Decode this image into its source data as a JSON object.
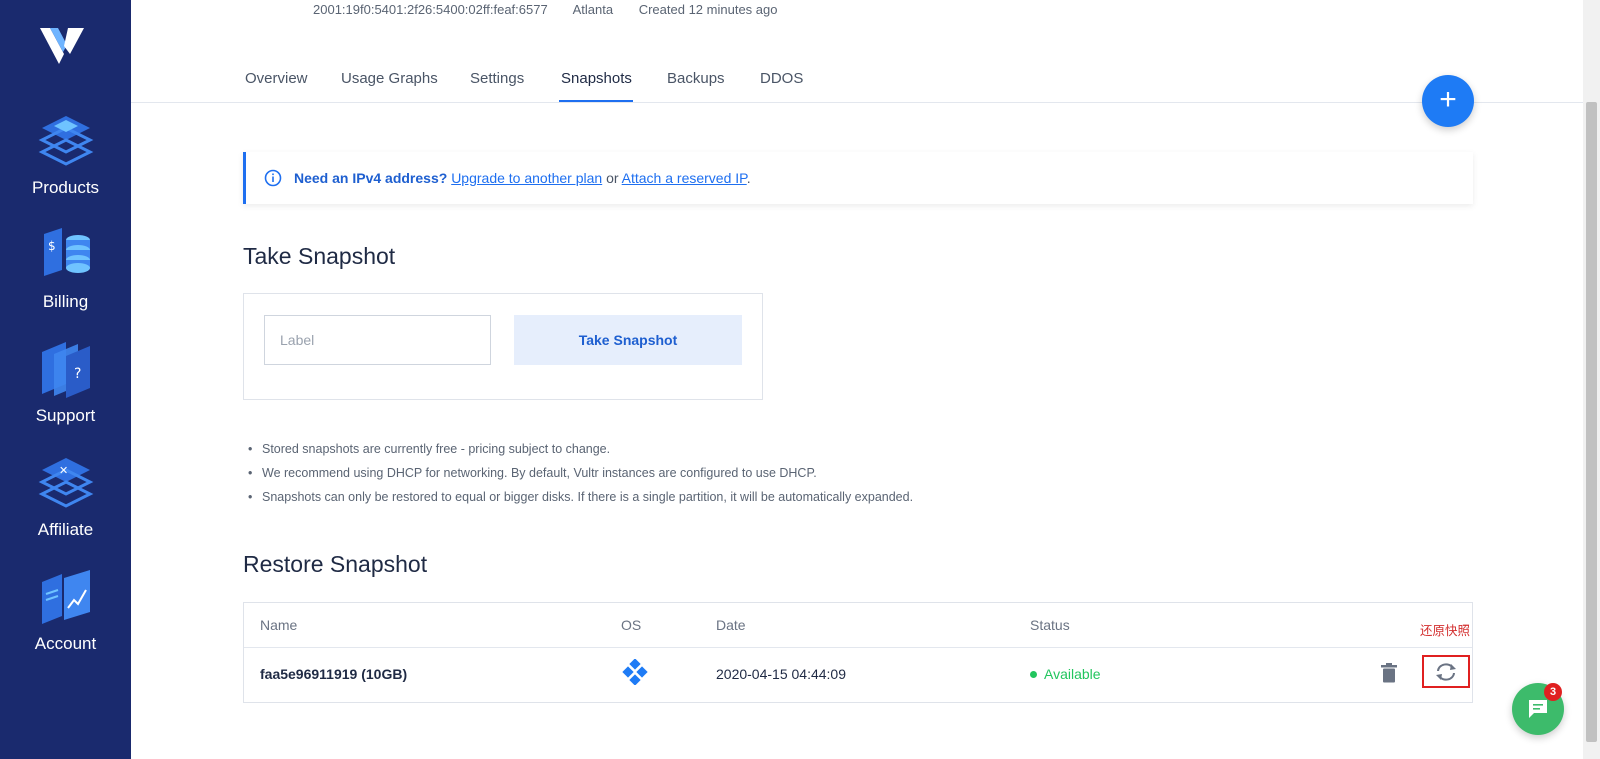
{
  "sidebar": {
    "items": [
      {
        "label": "Products",
        "icon": "products-icon"
      },
      {
        "label": "Billing",
        "icon": "billing-icon"
      },
      {
        "label": "Support",
        "icon": "support-icon"
      },
      {
        "label": "Affiliate",
        "icon": "affiliate-icon"
      },
      {
        "label": "Account",
        "icon": "account-icon"
      }
    ]
  },
  "server": {
    "ipv6": "2001:19f0:5401:2f26:5400:02ff:feaf:6577",
    "location": "Atlanta",
    "created": "Created 12 minutes ago"
  },
  "tabs": [
    "Overview",
    "Usage Graphs",
    "Settings",
    "Snapshots",
    "Backups",
    "DDOS"
  ],
  "active_tab": "Snapshots",
  "fab_label": "+",
  "alert": {
    "bold": "Need an IPv4 address?",
    "link1": "Upgrade to another plan",
    "or": "or",
    "link2": "Attach a reserved IP",
    "end": "."
  },
  "take_snapshot": {
    "heading": "Take Snapshot",
    "label_placeholder": "Label",
    "button": "Take Snapshot"
  },
  "notes": [
    "Stored snapshots are currently free - pricing subject to change.",
    "We recommend using DHCP for networking. By default, Vultr instances are configured to use DHCP.",
    "Snapshots can only be restored to equal or bigger disks. If there is a single partition, it will be automatically expanded."
  ],
  "restore_snapshot": {
    "heading": "Restore Snapshot",
    "columns": [
      "Name",
      "OS",
      "Date",
      "Status"
    ],
    "rows": [
      {
        "name": "faa5e96911919 (10GB)",
        "os_icon": "os-icon",
        "date": "2020-04-15 04:44:09",
        "status": "Available"
      }
    ],
    "annotation": "还原快照"
  },
  "chat": {
    "badge": "3"
  },
  "colors": {
    "sidebar_bg": "#1a2a6e",
    "accent": "#1e6ff0",
    "status_available": "#22c55e",
    "annotation_red": "#e02020",
    "chat_green": "#3dbb6b"
  }
}
